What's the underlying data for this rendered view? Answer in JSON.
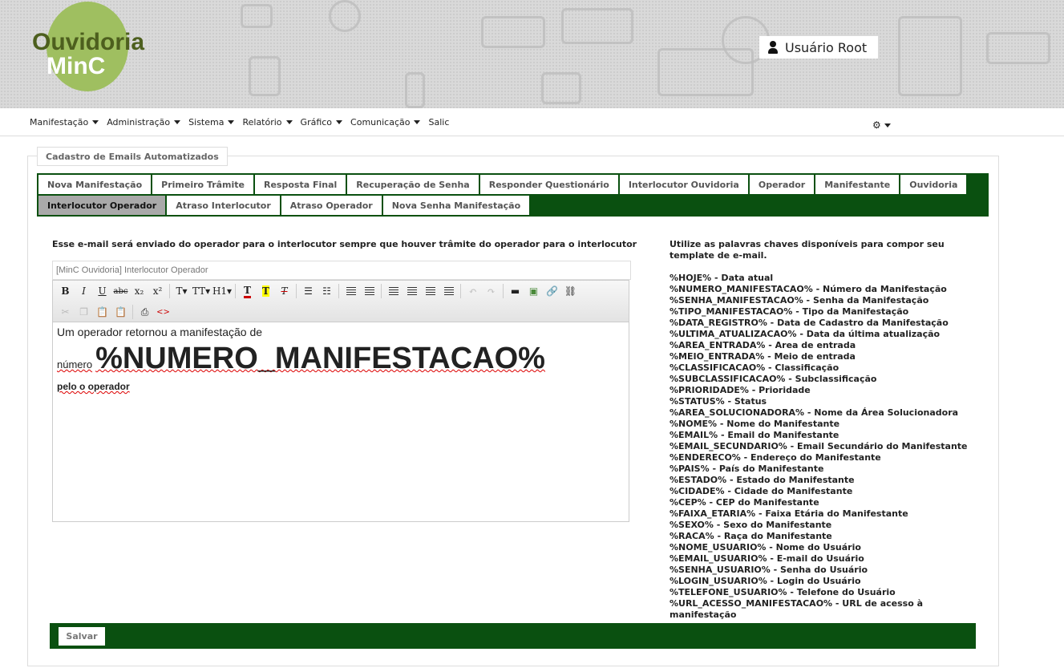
{
  "header": {
    "logo_line1": "Ouvidoria",
    "logo_line2": "MinC",
    "user_label": "Usuário Root"
  },
  "menu": {
    "items": [
      "Manifestação",
      "Administração",
      "Sistema",
      "Relatório",
      "Gráfico",
      "Comunicação",
      "Salic"
    ],
    "settings_icon": "gear-icon"
  },
  "page": {
    "legend": "Cadastro de Emails Automatizados"
  },
  "tabs": {
    "row1": [
      "Nova Manifestação",
      "Primeiro Trâmite",
      "Resposta Final",
      "Recuperação de Senha",
      "Responder Questionário",
      "Interlocutor Ouvidoria",
      "Operador",
      "Manifestante",
      "Ouvidoria"
    ],
    "row2": [
      "Interlocutor Operador",
      "Atraso Interlocutor",
      "Atraso Operador",
      "Nova Senha Manifestação"
    ],
    "active": "Interlocutor Operador"
  },
  "form": {
    "description": "Esse e-mail será enviado do operador para o interlocutor sempre que houver trâmite do operador para o interlocutor",
    "subject": "[MinC Ouvidoria] Interlocutor Operador",
    "body_line1": "Um operador retornou a manifestação de",
    "body_line2_small": "número",
    "body_line2_big": "%NUMERO_MANIFESTACAO%",
    "body_line3": "pelo o operador",
    "save_label": "Salvar"
  },
  "toolbar": {
    "row1": [
      "B",
      "I",
      "U",
      "abc",
      "x₂",
      "x²",
      "T▾",
      "TT▾",
      "H1▾"
    ]
  },
  "help": {
    "title": "Utilize as palavras chaves disponíveis para compor seu template de e-mail.",
    "keywords": [
      "%HOJE% - Data atual",
      "%NUMERO_MANIFESTACAO% - Número da Manifestação",
      "%SENHA_MANIFESTACAO% - Senha da Manifestação",
      "%TIPO_MANIFESTACAO% - Tipo da Manifestação",
      "%DATA_REGISTRO% - Data de Cadastro da Manifestação",
      "%ULTIMA_ATUALIZACAO% - Data da última atualização",
      "%AREA_ENTRADA% - Area de entrada",
      "%MEIO_ENTRADA% - Meio de entrada",
      "%CLASSIFICACAO% - Classificação",
      "%SUBCLASSIFICACAO% - Subclassificação",
      "%PRIORIDADE% - Prioridade",
      "%STATUS% - Status",
      "%AREA_SOLUCIONADORA% - Nome da Área Solucionadora",
      "%NOME% - Nome do Manifestante",
      "%EMAIL% - Email do Manifestante",
      "%EMAIL_SECUNDARIO% - Email Secundário do Manifestante",
      "%ENDERECO% - Endereço do Manifestante",
      "%PAIS% - País do Manifestante",
      "%ESTADO% - Estado do Manifestante",
      "%CIDADE% - Cidade do Manifestante",
      "%CEP% - CEP do Manifestante",
      "%FAIXA_ETARIA% - Faixa Etária do Manifestante",
      "%SEXO% - Sexo do Manifestante",
      "%RACA% - Raça do Manifestante",
      "%NOME_USUARIO% - Nome do Usuário",
      "%EMAIL_USUARIO% - E-mail do Usuário",
      "%SENHA_USUARIO% - Senha do Usuário",
      "%LOGIN_USUARIO% - Login do Usuário",
      "%TELEFONE_USUARIO% - Telefone do Usuário",
      "%URL_ACESSO_MANIFESTACAO% - URL de acesso à manifestação"
    ]
  },
  "colors": {
    "brand_green": "#0a5010",
    "logo_green": "#9fbf60",
    "logo_text": "#4d5f1e"
  }
}
